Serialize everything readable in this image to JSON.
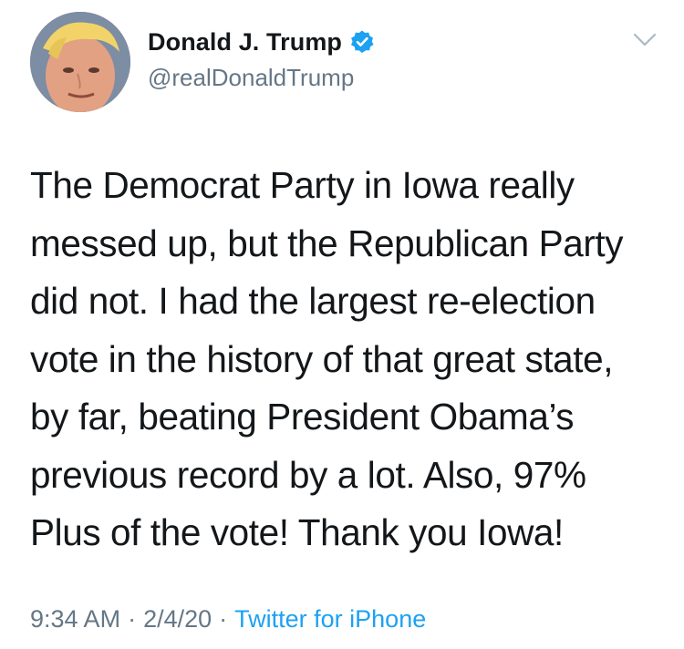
{
  "user": {
    "name": "Donald J. Trump",
    "handle": "@realDonaldTrump",
    "verified": true,
    "avatar_icon": "profile-photo"
  },
  "tweet": {
    "lines": [
      "The Democrat Party in Iowa really",
      "messed up, but the Republican Party",
      "did not. I had the largest re-election",
      "vote in the history of that great state,",
      "by far, beating President Obama’s",
      "previous record by a lot. Also, 97%",
      "Plus of the vote! Thank you Iowa!"
    ]
  },
  "meta": {
    "time": "9:34 AM",
    "date": "2/4/20",
    "separator": "·",
    "source": "Twitter for iPhone"
  },
  "colors": {
    "link": "#1da1f2",
    "secondary_text": "#657786",
    "primary_text": "#14171a"
  },
  "icons": {
    "menu": "chevron-down-icon",
    "verified": "verified-badge-icon"
  }
}
